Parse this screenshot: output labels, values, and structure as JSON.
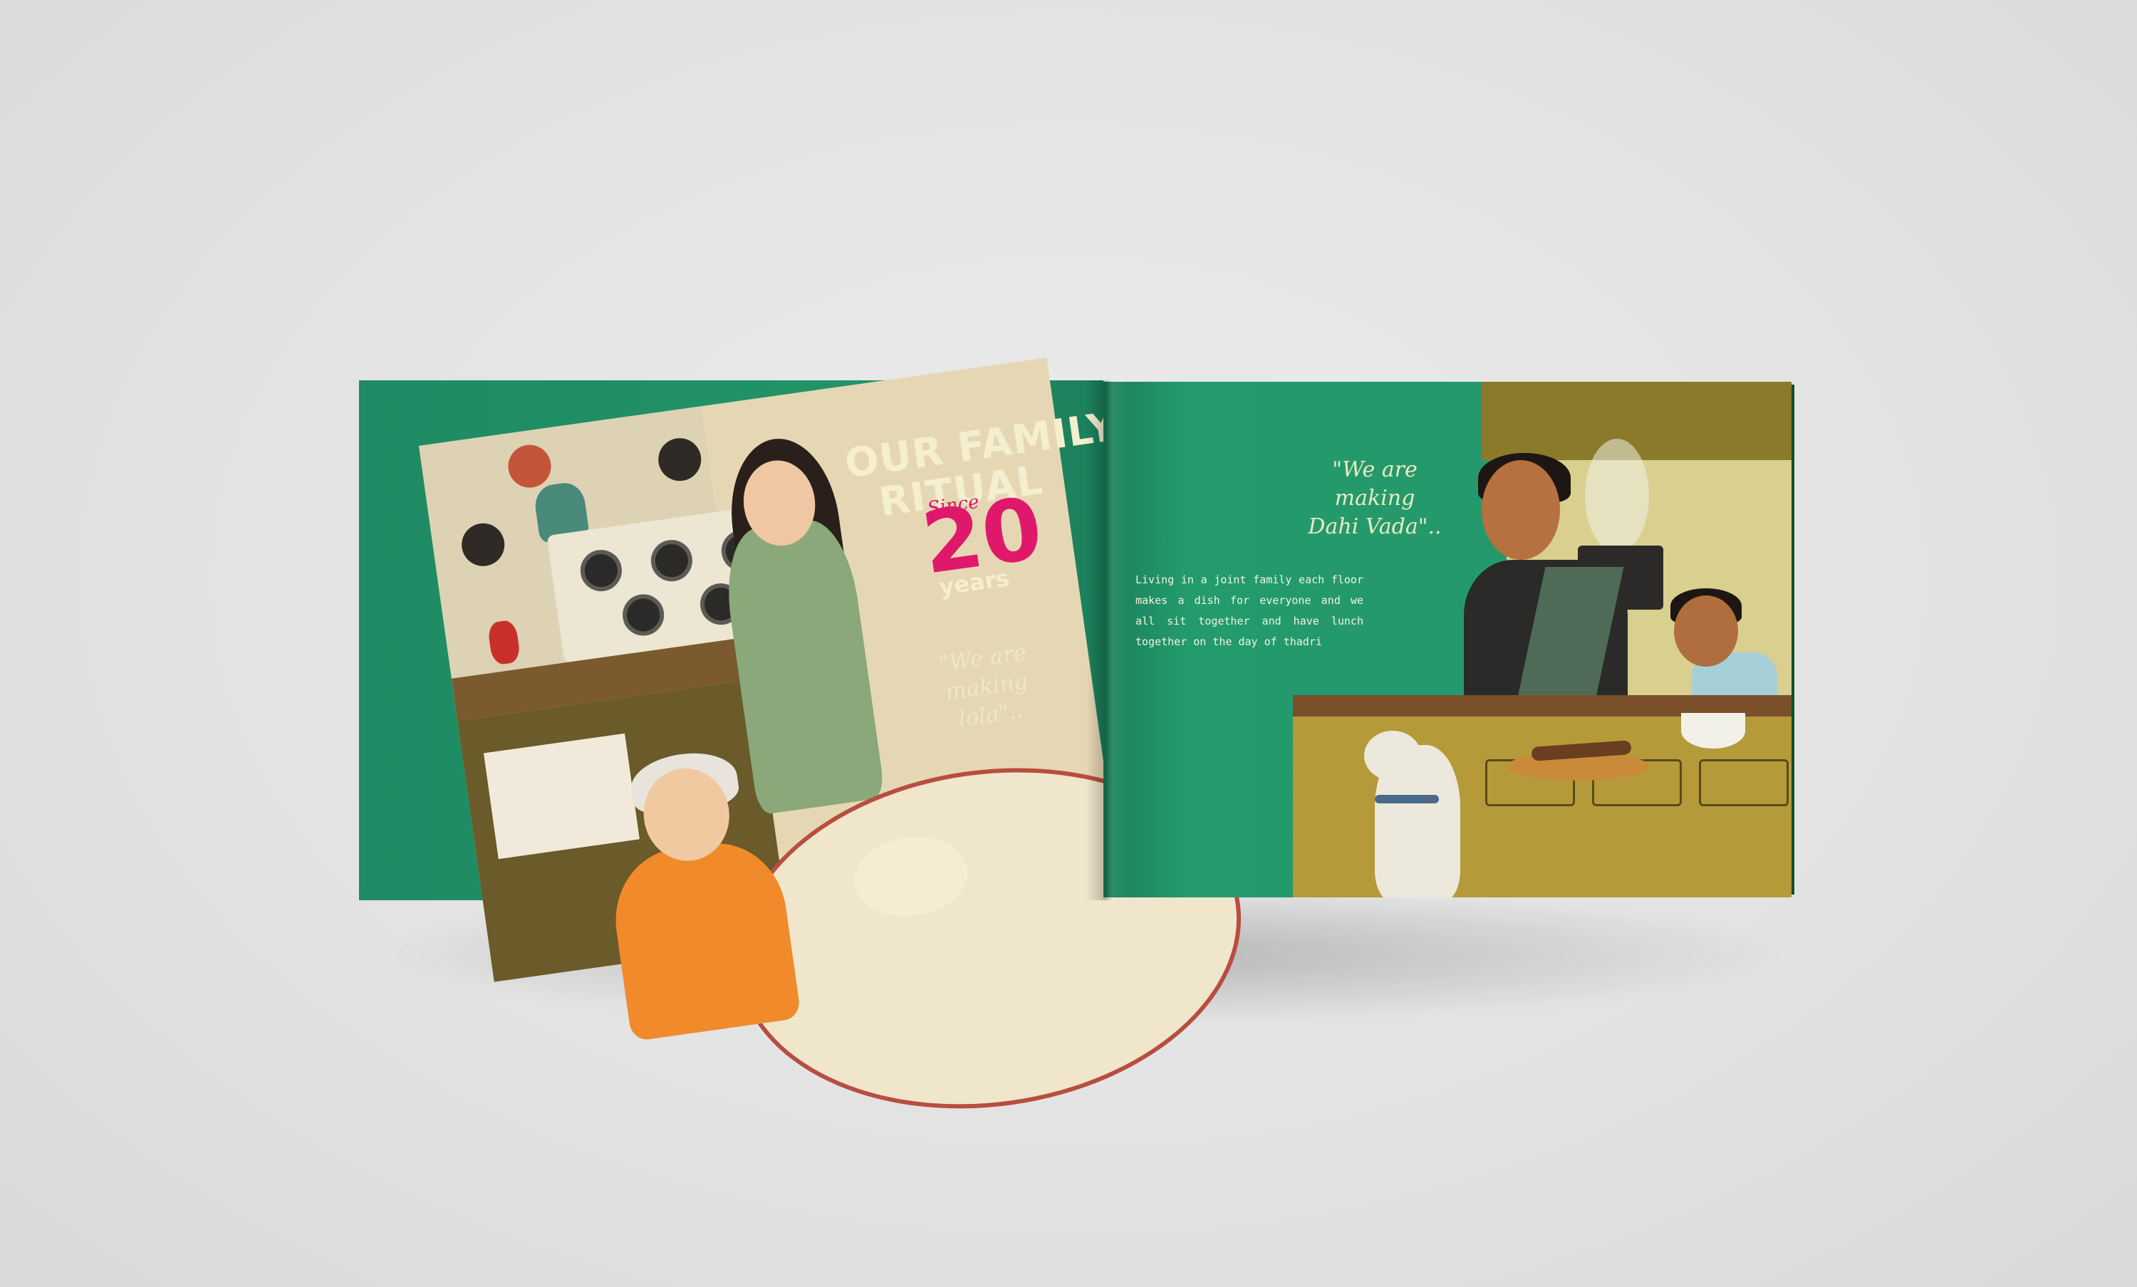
{
  "left_page": {
    "title_line_1": "OUR FAMILY",
    "title_line_2": "RITUAL",
    "since": "Since",
    "years_number": "20",
    "years_word": "years",
    "quote_line_1": "\"We are making",
    "quote_line_2": "lola\"..",
    "illustration": "kitchen-grandmother-rolling-dough-illustration"
  },
  "right_page": {
    "quote_line_1": "\"We are making",
    "quote_line_2": "Dahi Vada\"..",
    "body_text": "Living in a joint family each floor makes a dish for everyone and we all sit together and have lunch together on the day of thadri",
    "illustration": "kitchen-mother-son-dog-illustration"
  },
  "colors": {
    "page_green": "#229468",
    "title_cream": "#f3efcf",
    "accent_pink": "#e0186c",
    "background": "#e4e4e4"
  }
}
